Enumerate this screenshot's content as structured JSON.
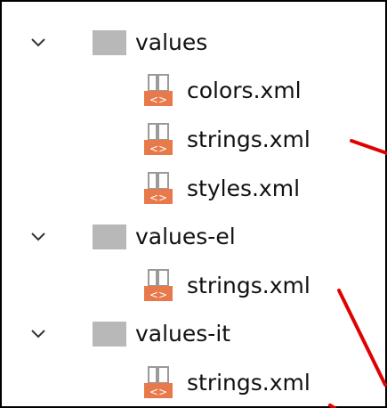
{
  "tree": {
    "items": [
      {
        "type": "folder",
        "label": "values",
        "expanded": true
      },
      {
        "type": "file",
        "label": "colors.xml"
      },
      {
        "type": "file",
        "label": "strings.xml"
      },
      {
        "type": "file",
        "label": "styles.xml"
      },
      {
        "type": "folder",
        "label": "values-el",
        "expanded": true
      },
      {
        "type": "file",
        "label": "strings.xml"
      },
      {
        "type": "folder",
        "label": "values-it",
        "expanded": true
      },
      {
        "type": "file",
        "label": "strings.xml"
      }
    ]
  },
  "icons": {
    "chevron": "chevron-down-icon",
    "folder": "folder-icon",
    "file": "xml-file-icon"
  },
  "colors": {
    "folder_gray": "#b8b8b8",
    "xml_badge": "#e8794a",
    "annotation_red": "#e00000",
    "border": "#000000"
  }
}
